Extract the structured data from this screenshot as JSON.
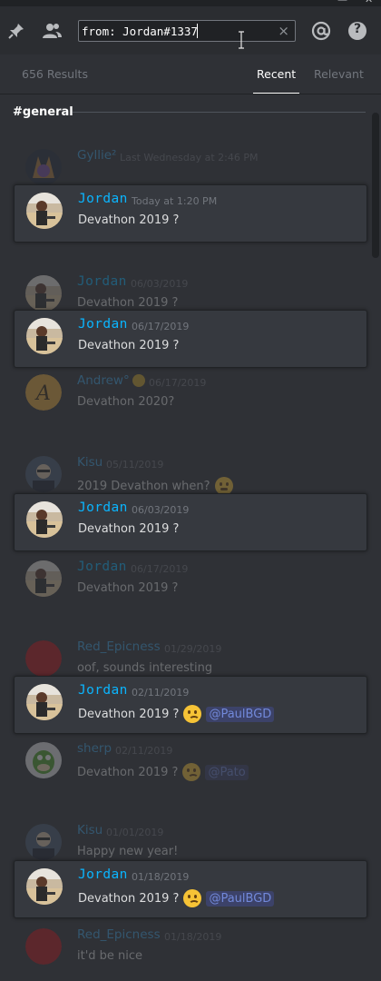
{
  "window": {
    "minimize": "—",
    "close": "✕"
  },
  "toolbar": {
    "pinned_icon": "pin-icon",
    "members_icon": "people-icon",
    "search_value": "from: Jordan#1337",
    "search_clear": "×",
    "mention_icon": "at-icon",
    "help_icon": "help-icon",
    "help_label": "?"
  },
  "tabs": {
    "results": "656 Results",
    "recent": "Recent",
    "relevant": "Relevant"
  },
  "channel": "#general",
  "colors": {
    "jordan": "#0ab5ff",
    "context_user": "#3ea1e0",
    "mention_bg": "#3c4269",
    "mention_fg": "#7289da"
  },
  "messages": [
    {
      "user": "Gyllie²",
      "time": "Last Wednesday at 2:46 PM",
      "text": "",
      "hit": false,
      "avatar": "gyllie"
    },
    {
      "user": "Jordan",
      "time": "Today at 1:20 PM",
      "text": "Devathon 2019 ?",
      "hit": true,
      "avatar": "jordan"
    },
    {
      "user": "Jordan",
      "time": "06/03/2019",
      "text": "Devathon 2019 ?",
      "hit": false,
      "avatar": "jordan"
    },
    {
      "user": "Jordan",
      "time": "06/17/2019",
      "text": "Devathon 2019 ?",
      "hit": true,
      "avatar": "jordan"
    },
    {
      "user": "Andrew°",
      "time": "06/17/2019",
      "text": "Devathon 2020?",
      "hit": false,
      "avatar": "andrew"
    },
    {
      "user": "Kisu",
      "time": "05/11/2019",
      "text": "2019 Devathon when?",
      "hit": false,
      "avatar": "kisu"
    },
    {
      "user": "Jordan",
      "time": "06/03/2019",
      "text": "Devathon 2019 ?",
      "hit": true,
      "avatar": "jordan"
    },
    {
      "user": "Jordan",
      "time": "06/17/2019",
      "text": "Devathon 2019 ?",
      "hit": false,
      "avatar": "jordan"
    },
    {
      "user": "Red_Epicness",
      "time": "01/29/2019",
      "text": "oof, sounds interesting",
      "hit": false,
      "avatar": "red"
    },
    {
      "user": "Jordan",
      "time": "02/11/2019",
      "text": "Devathon 2019 ?",
      "mention": "@PaulBGD",
      "hit": true,
      "avatar": "jordan"
    },
    {
      "user": "sherp",
      "time": "02/11/2019",
      "text": "Devathon 2019 ?",
      "mention": "@Pato",
      "hit": false,
      "avatar": "sherp"
    },
    {
      "user": "Kisu",
      "time": "01/01/2019",
      "text": "Happy new year!",
      "hit": false,
      "avatar": "kisu"
    },
    {
      "user": "Jordan",
      "time": "01/18/2019",
      "text": "Devathon 2019 ?",
      "mention": "@PaulBGD",
      "hit": true,
      "avatar": "jordan"
    },
    {
      "user": "Red_Epicness",
      "time": "01/18/2019",
      "text": "it'd be nice",
      "hit": false,
      "avatar": "red"
    }
  ]
}
